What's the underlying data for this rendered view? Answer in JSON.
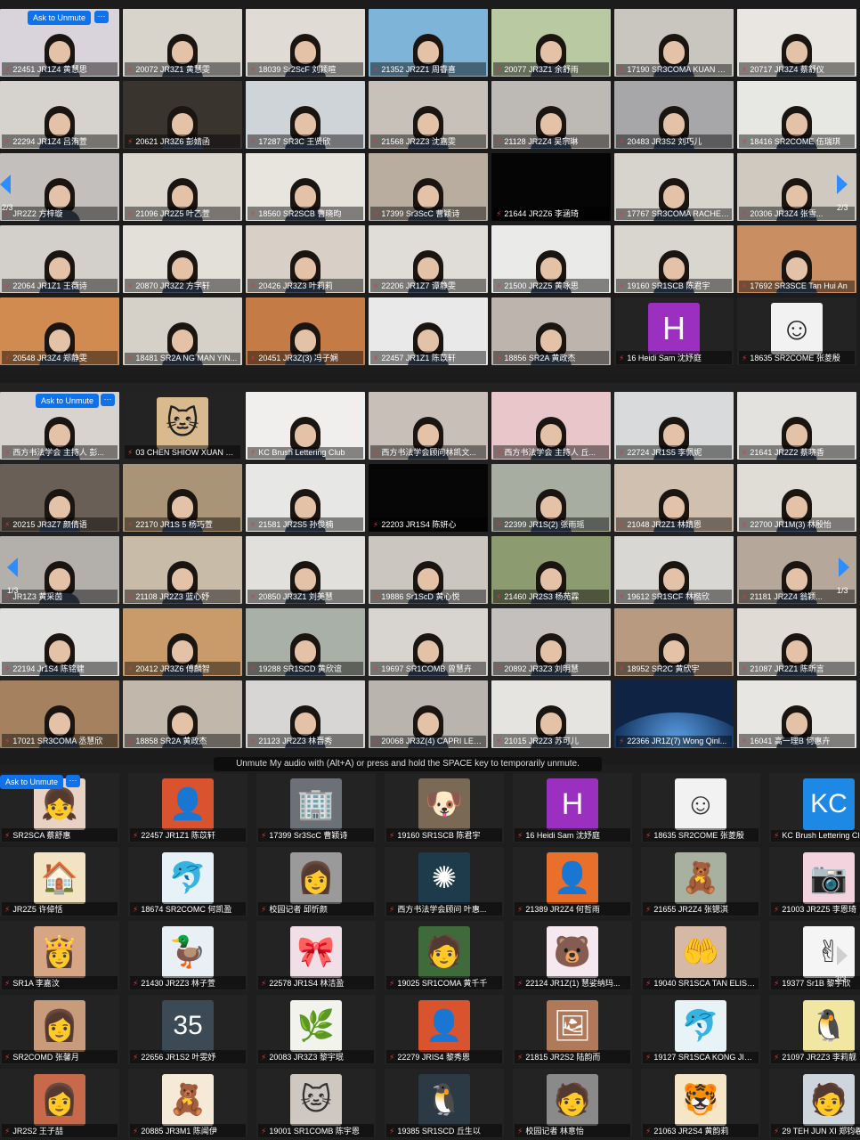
{
  "panel1": {
    "ask_label": "Ask to Unmute",
    "more_label": "···",
    "page_left": "2/3",
    "page_right": "2/3",
    "tiles": [
      {
        "label": "22451 JR1Z4 黄慧思",
        "bg": "#d9d4db",
        "kind": "person"
      },
      {
        "label": "20072 JR3Z1 黄慧雯",
        "bg": "#d8d4cc",
        "kind": "person"
      },
      {
        "label": "18039 Sr2ScF 刘颖暄",
        "bg": "#e0dcd5",
        "kind": "person"
      },
      {
        "label": "21352 JR2Z1 周睿喜",
        "bg": "#7fb4d9",
        "kind": "person"
      },
      {
        "label": "20077 JR3Z1 余舒雨",
        "bg": "#b9c9a2",
        "kind": "person"
      },
      {
        "label": "17190 SR3COMA KUAN K...",
        "bg": "#c9c6bf",
        "kind": "person"
      },
      {
        "label": "20717 JR3Z4 蔡舒仪",
        "bg": "#e9e6e1",
        "kind": "person"
      },
      {
        "label": "22294 JR1Z4 吕洧萱",
        "bg": "#d6d3ce",
        "kind": "person"
      },
      {
        "label": "20621 JR3Z6 彭婧函",
        "bg": "#3a342f",
        "kind": "person"
      },
      {
        "label": "17287 SR3C 王贤欣",
        "bg": "#cfd4d9",
        "kind": "person"
      },
      {
        "label": "21568 JR2Z3 沈嘉雯",
        "bg": "#c7c1b9",
        "kind": "person"
      },
      {
        "label": "21128 JR2Z4 吴宗琳",
        "bg": "#bdb9b4",
        "kind": "person"
      },
      {
        "label": "20483 JR3S2 刘巧儿",
        "bg": "#a7a7a9",
        "kind": "person"
      },
      {
        "label": "18416 SR2COME 伍瑞琪",
        "bg": "#e7e7e4",
        "kind": "person"
      },
      {
        "label": "JR2Z2 方梓璇",
        "bg": "#c2bfbc",
        "kind": "person"
      },
      {
        "label": "21096 JR2Z5 叶乙萱",
        "bg": "#dcd7cf",
        "kind": "person"
      },
      {
        "label": "18560 SR2SCB 曹晓昀",
        "bg": "#e8e5df",
        "kind": "person"
      },
      {
        "label": "17399 Sr3ScC 曹颖诗",
        "bg": "#b8ad9f",
        "kind": "person"
      },
      {
        "label": "21644 JR2Z6 李涵琦",
        "bg": "#050505",
        "kind": "black"
      },
      {
        "label": "17767 SR3COMA RACHEL...",
        "bg": "#d7d3cd",
        "kind": "person"
      },
      {
        "label": "20306 JR3Z4 张雪...",
        "bg": "#cfc9c0",
        "kind": "person"
      },
      {
        "label": "22064 JR1Z1 王薇诗",
        "bg": "#d3d0cb",
        "kind": "person"
      },
      {
        "label": "20870 JR3Z2 方宇轩",
        "bg": "#e3e0da",
        "kind": "person"
      },
      {
        "label": "20426 JR3Z3 叶莉莉",
        "bg": "#d8cfc6",
        "kind": "person"
      },
      {
        "label": "22206 JR1Z7 谭静雯",
        "bg": "#e0ddd8",
        "kind": "person"
      },
      {
        "label": "21500 JR2Z5 黄咏思",
        "bg": "#eaeae8",
        "kind": "person"
      },
      {
        "label": "19160 SR1SCB 陈君宇",
        "bg": "#d9d6d0",
        "kind": "person"
      },
      {
        "label": "17692 SR3SCE Tan Hui An",
        "bg": "#c98f63",
        "kind": "person"
      },
      {
        "label": "20548 JR3Z4 郑静雯",
        "bg": "#d18a4f",
        "kind": "person"
      },
      {
        "label": "18481 SR2A NG MAN YIN...",
        "bg": "#d6d1c8",
        "kind": "person"
      },
      {
        "label": "20451 JR3Z(3) 冯子娴",
        "bg": "#c57b45",
        "kind": "person"
      },
      {
        "label": "22457 JR1Z1 陈苡轩",
        "bg": "#e9e9e9",
        "kind": "person"
      },
      {
        "label": "18856 SR2A 黄政杰",
        "bg": "#bdb5ad",
        "kind": "person"
      },
      {
        "label": "16 Heidi Sam 沈妤庭",
        "bg": "#232323",
        "kind": "avatar",
        "letter": "H",
        "color": "#9b2fbf"
      },
      {
        "label": "18635 SR2COME 张菱殷",
        "bg": "#232323",
        "kind": "avatar",
        "letter": "☺",
        "color": "#f2f2f2"
      }
    ]
  },
  "panel2": {
    "ask_label": "Ask to Unmute",
    "more_label": "···",
    "page_left": "1/3",
    "page_right": "1/3",
    "tiles": [
      {
        "label": "西方书法学会 主持人 彭...",
        "bg": "#d9d3cf",
        "kind": "person"
      },
      {
        "label": "03 CHEN SHIOW XUAN 曾晓...",
        "bg": "#232323",
        "kind": "avatar",
        "letter": "🐱",
        "color": "#d9b98e"
      },
      {
        "label": "KC Brush Lettering Club",
        "bg": "#f0efed",
        "kind": "person"
      },
      {
        "label": "西方书法学会顾问林凯文...",
        "bg": "#c8bfb9",
        "kind": "person"
      },
      {
        "label": "西方书法学会 主持人 丘...",
        "bg": "#e9c6c9",
        "kind": "person"
      },
      {
        "label": "22724 JR1S5 李佩妮",
        "bg": "#d9dadb",
        "kind": "person"
      },
      {
        "label": "21641 JR2Z2 蔡晓香",
        "bg": "#e3e2df",
        "kind": "person"
      },
      {
        "label": "20215 JR3Z7 颜倩语",
        "bg": "#6a5f57",
        "kind": "person"
      },
      {
        "label": "22170 JR1S 5 杨巧萱",
        "bg": "#a99477",
        "kind": "person"
      },
      {
        "label": "21581 JR2S5 孙俊楠",
        "bg": "#e7e7e5",
        "kind": "person"
      },
      {
        "label": "22203 JR1S4 陈妍心",
        "bg": "#060606",
        "kind": "black"
      },
      {
        "label": "22399 JR1S(2) 张雨瑶",
        "bg": "#a7ada0",
        "kind": "person"
      },
      {
        "label": "21048 JR2Z1 林婧恩",
        "bg": "#cfc0b0",
        "kind": "person"
      },
      {
        "label": "22700 JR1M(3) 林殷怡",
        "bg": "#e0dcd6",
        "kind": "person"
      },
      {
        "label": "JR1Z3 黄采茵",
        "bg": "#b3b0ab",
        "kind": "person"
      },
      {
        "label": "21108 JR2Z3 蓝心妤",
        "bg": "#c8bca9",
        "kind": "person"
      },
      {
        "label": "20850 JR3Z1 刘美慧",
        "bg": "#e2e0dd",
        "kind": "person"
      },
      {
        "label": "19886 Sr1ScD 黄心悦",
        "bg": "#cbc6bf",
        "kind": "person"
      },
      {
        "label": "21460 JR2S3 杨苑霖",
        "bg": "#8d9b70",
        "kind": "person"
      },
      {
        "label": "19612 SR1SCF 林楷欣",
        "bg": "#d9d7d3",
        "kind": "person"
      },
      {
        "label": "21181 JR2Z4 翁颖...",
        "bg": "#b5a89a",
        "kind": "person"
      },
      {
        "label": "22194 Jr1S4 陈铭建",
        "bg": "#e1e1e0",
        "kind": "person"
      },
      {
        "label": "20412 JR3Z6 傅麟智",
        "bg": "#c99b6a",
        "kind": "person"
      },
      {
        "label": "19288 SR1SCD 黄欣谊",
        "bg": "#a9b0a7",
        "kind": "person"
      },
      {
        "label": "19697 SR1COMB 曾慧卉",
        "bg": "#d8d5d0",
        "kind": "person"
      },
      {
        "label": "20892 JR3Z3 刘明慧",
        "bg": "#c3c0bd",
        "kind": "person"
      },
      {
        "label": "18952 SR2C 黄欣宇",
        "bg": "#b79a7f",
        "kind": "person"
      },
      {
        "label": "21087 JR2Z1 陈昕言",
        "bg": "#e0dcd5",
        "kind": "person"
      },
      {
        "label": "17021 SR3COMA 丞慧欣",
        "bg": "#a58160",
        "kind": "person"
      },
      {
        "label": "18858 SR2A 黄政杰",
        "bg": "#c1b7ab",
        "kind": "person"
      },
      {
        "label": "21123 JR2Z3 林晋秀",
        "bg": "#d7d6d4",
        "kind": "person"
      },
      {
        "label": "20068 JR3Z(4) CAPRI LEE...",
        "bg": "#b9b4ae",
        "kind": "person"
      },
      {
        "label": "21015 JR2Z3 苏可儿",
        "bg": "#e6e4e1",
        "kind": "person"
      },
      {
        "label": "22366 JR1Z(7) Wong Qinl...",
        "bg": "#0f2344",
        "kind": "earth"
      },
      {
        "label": "16041 高一理B 何惠卉",
        "bg": "#e8e6e3",
        "kind": "person"
      }
    ]
  },
  "panel3": {
    "ask_label": "Ask to Unmute",
    "more_label": "···",
    "page_right": "3/3",
    "tooltip": "Unmute My audio with (Alt+A) or press and hold the SPACE key to temporarily unmute.",
    "tiles": [
      {
        "label": "SR2SCA 蔡舒惠",
        "color": "#e7d2c4",
        "letter": "👧"
      },
      {
        "label": "22457 JR1Z1 陈苡轩",
        "color": "#d9532f",
        "letter": "👤"
      },
      {
        "label": "17399 Sr3ScC 曹颖诗",
        "color": "#6c7178",
        "letter": "🏢"
      },
      {
        "label": "19160 SR1SCB 陈君宇",
        "color": "#7a6a55",
        "letter": "🐶"
      },
      {
        "label": "16 Heidi Sam 沈妤庭",
        "color": "#9b2fbf",
        "letter": "H"
      },
      {
        "label": "18635 SR2COME 张菱殷",
        "color": "#f2f2f2",
        "letter": "☺"
      },
      {
        "label": "KC Brush Lettering Club",
        "color": "#1e88e5",
        "letter": "KC"
      },
      {
        "label": "JR2Z5 许倬恬",
        "color": "#f2e3c2",
        "letter": "🏠"
      },
      {
        "label": "18674 SR2COMC 何凯盈",
        "color": "#e6f2f7",
        "letter": "🐬"
      },
      {
        "label": "校园记者 邱忻颜",
        "color": "#9a9a9a",
        "letter": "👩"
      },
      {
        "label": "西方书法学会顾问 叶惠...",
        "color": "#1d3b4a",
        "letter": "✺"
      },
      {
        "label": "21389 JR2Z4 何哲雨",
        "color": "#e8702a",
        "letter": "👤"
      },
      {
        "label": "21655 JR2Z4 张锶淇",
        "color": "#a8b0a0",
        "letter": "🧸"
      },
      {
        "label": "21003 JR2Z5 李恩琦",
        "color": "#f3d3dd",
        "letter": "📷"
      },
      {
        "label": "SR1A 李嘉汶",
        "color": "#d6a584",
        "letter": "👸"
      },
      {
        "label": "21430 JR2Z3 林子萱",
        "color": "#e9f0f5",
        "letter": "🦆"
      },
      {
        "label": "22578 JR1S4 林洁盈",
        "color": "#f1dfe8",
        "letter": "🎀"
      },
      {
        "label": "19025 SR1COMA 黄千千",
        "color": "#3f6a3a",
        "letter": "🧑"
      },
      {
        "label": "22124 JR1Z(1) 慧娑纳玛...",
        "color": "#f6e8ef",
        "letter": "🐻"
      },
      {
        "label": "19040 SR1SCA TAN ELISE...",
        "color": "#d5b8a5",
        "letter": "🤲"
      },
      {
        "label": "19377 Sr1B 黎宇欣",
        "color": "#f5f5f5",
        "letter": "✌"
      },
      {
        "label": "SR2COMD 张馨月",
        "color": "#c89b7b",
        "letter": "👩"
      },
      {
        "label": "22656 JR1S2 叶雯妤",
        "color": "#3b4a54",
        "letter": "35"
      },
      {
        "label": "20083 JR3Z3 黎宇珉",
        "color": "#f3f3ee",
        "letter": "🌿"
      },
      {
        "label": "22279 JRIS4 黎秀恩",
        "color": "#d9532f",
        "letter": "👤"
      },
      {
        "label": "21815 JR2S2 陆韵而",
        "color": "#b07a5a",
        "letter": "🖼"
      },
      {
        "label": "19127 SR1SCA KONG JIA...",
        "color": "#e8f3f8",
        "letter": "🐬"
      },
      {
        "label": "21097 JR2Z3 李莉靓",
        "color": "#f1e6a2",
        "letter": "🐧"
      },
      {
        "label": "JR2S2 王子喆",
        "color": "#c86a4a",
        "letter": "👩"
      },
      {
        "label": "20885 JR3M1 陈闻伊",
        "color": "#f5e9d8",
        "letter": "🧸"
      },
      {
        "label": "19001 SR1COMB 陈宇恩",
        "color": "#cfc8c0",
        "letter": "🐱"
      },
      {
        "label": "19385 SR1SCD 丘生以",
        "color": "#2b3a45",
        "letter": "🐧"
      },
      {
        "label": "校园记者 林意怡",
        "color": "#8a8a8a",
        "letter": "🧑"
      },
      {
        "label": "21063 JR2S4 黄韵莉",
        "color": "#f5e6c8",
        "letter": "🐯"
      },
      {
        "label": "29 TEH JUN XI 郑钧羲",
        "color": "#cfd5dc",
        "letter": "🧑"
      }
    ]
  }
}
